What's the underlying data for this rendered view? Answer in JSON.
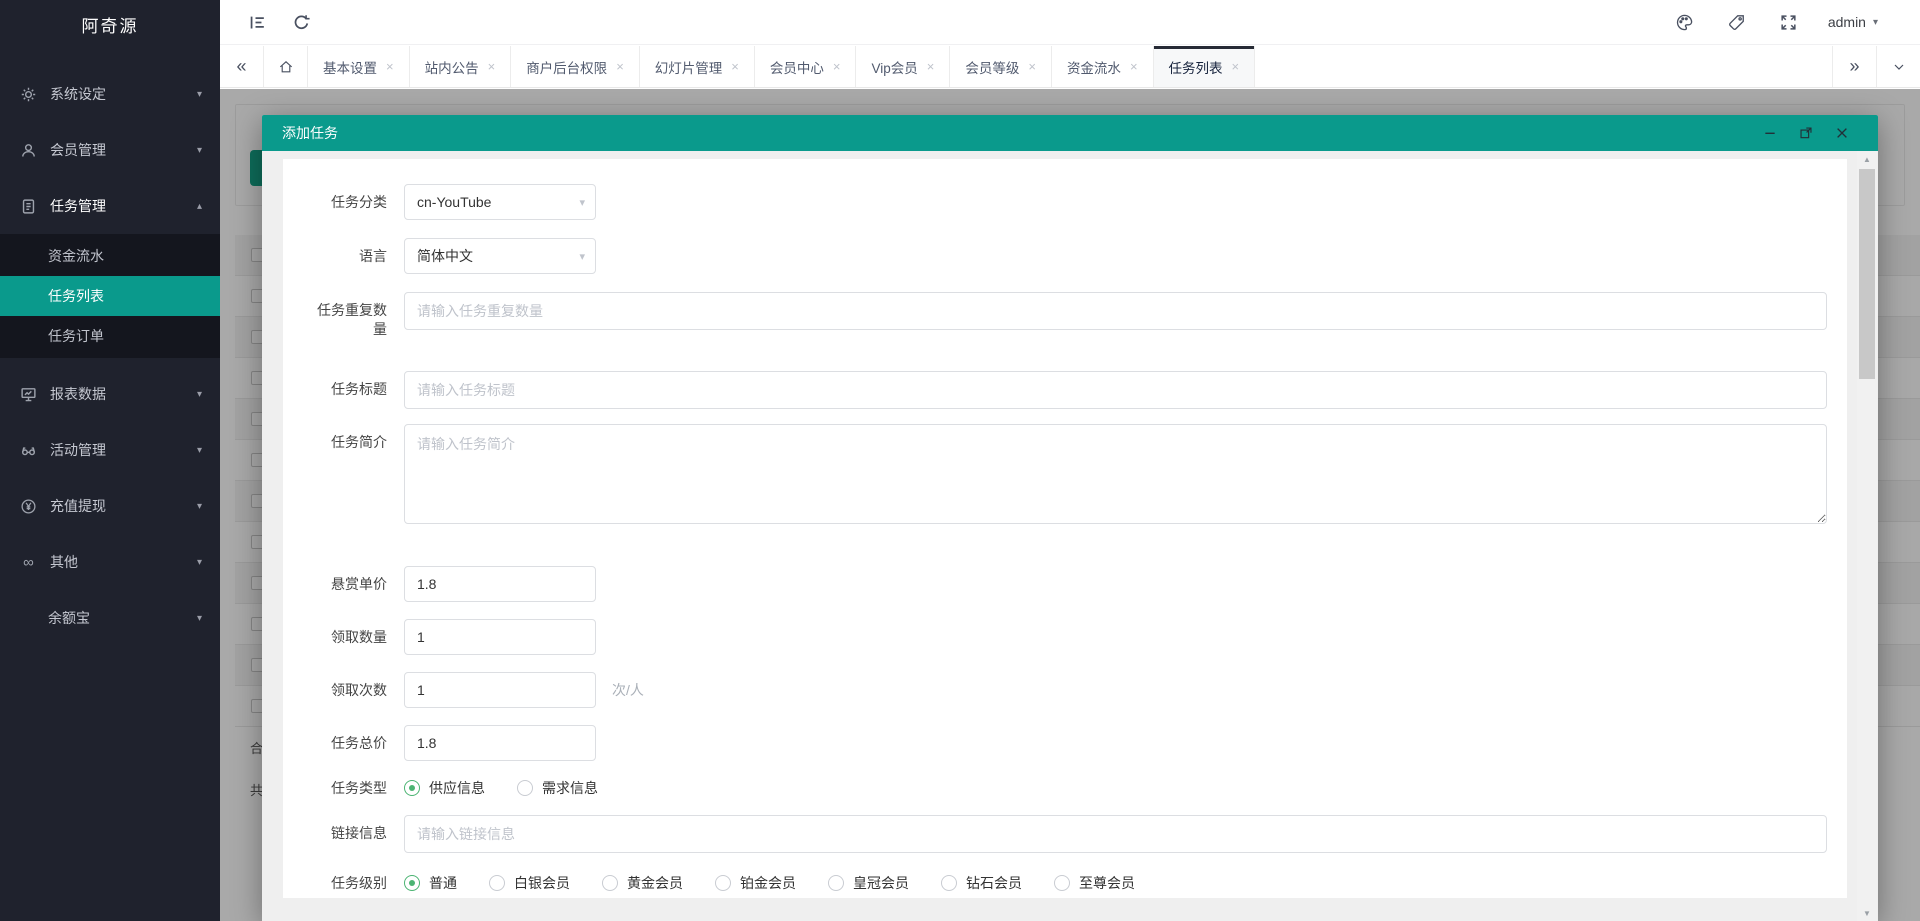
{
  "app": {
    "logo_text": "阿奇源",
    "accent_color": "#0a9a8c"
  },
  "topbar": {
    "username": "admin"
  },
  "tabbar": {
    "back_symbol": "«",
    "forward_symbol": "»",
    "close_symbol": "×",
    "tabs": [
      {
        "label": "基本设置"
      },
      {
        "label": "站内公告"
      },
      {
        "label": "商户后台权限"
      },
      {
        "label": "幻灯片管理"
      },
      {
        "label": "会员中心"
      },
      {
        "label": "Vip会员"
      },
      {
        "label": "会员等级"
      },
      {
        "label": "资金流水"
      },
      {
        "label": "任务列表",
        "active": true
      }
    ]
  },
  "sidebar": {
    "items": [
      {
        "label": "系统设定",
        "icon": "gear-icon"
      },
      {
        "label": "会员管理",
        "icon": "user-icon"
      },
      {
        "label": "任务管理",
        "icon": "tasks-icon",
        "expanded": true,
        "children": [
          {
            "label": "资金流水"
          },
          {
            "label": "任务列表",
            "active": true
          },
          {
            "label": "任务订单"
          }
        ]
      },
      {
        "label": "报表数据",
        "icon": "report-icon"
      },
      {
        "label": "活动管理",
        "icon": "activity-icon"
      },
      {
        "label": "充值提现",
        "icon": "recharge-icon"
      },
      {
        "label": "其他",
        "icon": "infinity-icon"
      },
      {
        "label": "余额宝",
        "icon": null
      }
    ]
  },
  "modal": {
    "title": "添加任务",
    "fields": {
      "category": {
        "label": "任务分类",
        "value": "cn-YouTube"
      },
      "language": {
        "label": "语言",
        "value": "简体中文"
      },
      "repeat_count": {
        "label": "任务重复数量",
        "placeholder": "请输入任务重复数量"
      },
      "task_title": {
        "label": "任务标题",
        "placeholder": "请输入任务标题"
      },
      "task_intro": {
        "label": "任务简介",
        "placeholder": "请输入任务简介"
      },
      "unit_price": {
        "label": "悬赏单价",
        "value": "1.8"
      },
      "claim_qty": {
        "label": "领取数量",
        "value": "1"
      },
      "claim_times": {
        "label": "领取次数",
        "value": "1",
        "suffix": "次/人"
      },
      "total_price": {
        "label": "任务总价",
        "value": "1.8"
      },
      "task_type": {
        "label": "任务类型",
        "options": [
          {
            "label": "供应信息",
            "checked": true
          },
          {
            "label": "需求信息",
            "checked": false
          }
        ]
      },
      "link_info": {
        "label": "链接信息",
        "placeholder": "请输入链接信息"
      },
      "task_level": {
        "label": "任务级别",
        "options": [
          {
            "label": "普通",
            "checked": true
          },
          {
            "label": "白银会员",
            "checked": false
          },
          {
            "label": "黄金会员",
            "checked": false
          },
          {
            "label": "铂金会员",
            "checked": false
          },
          {
            "label": "皇冠会员",
            "checked": false
          },
          {
            "label": "钻石会员",
            "checked": false
          },
          {
            "label": "至尊会员",
            "checked": false
          }
        ]
      }
    }
  },
  "background_page": {
    "partial_texts": {
      "total_row": "合",
      "count_row": "共"
    }
  }
}
